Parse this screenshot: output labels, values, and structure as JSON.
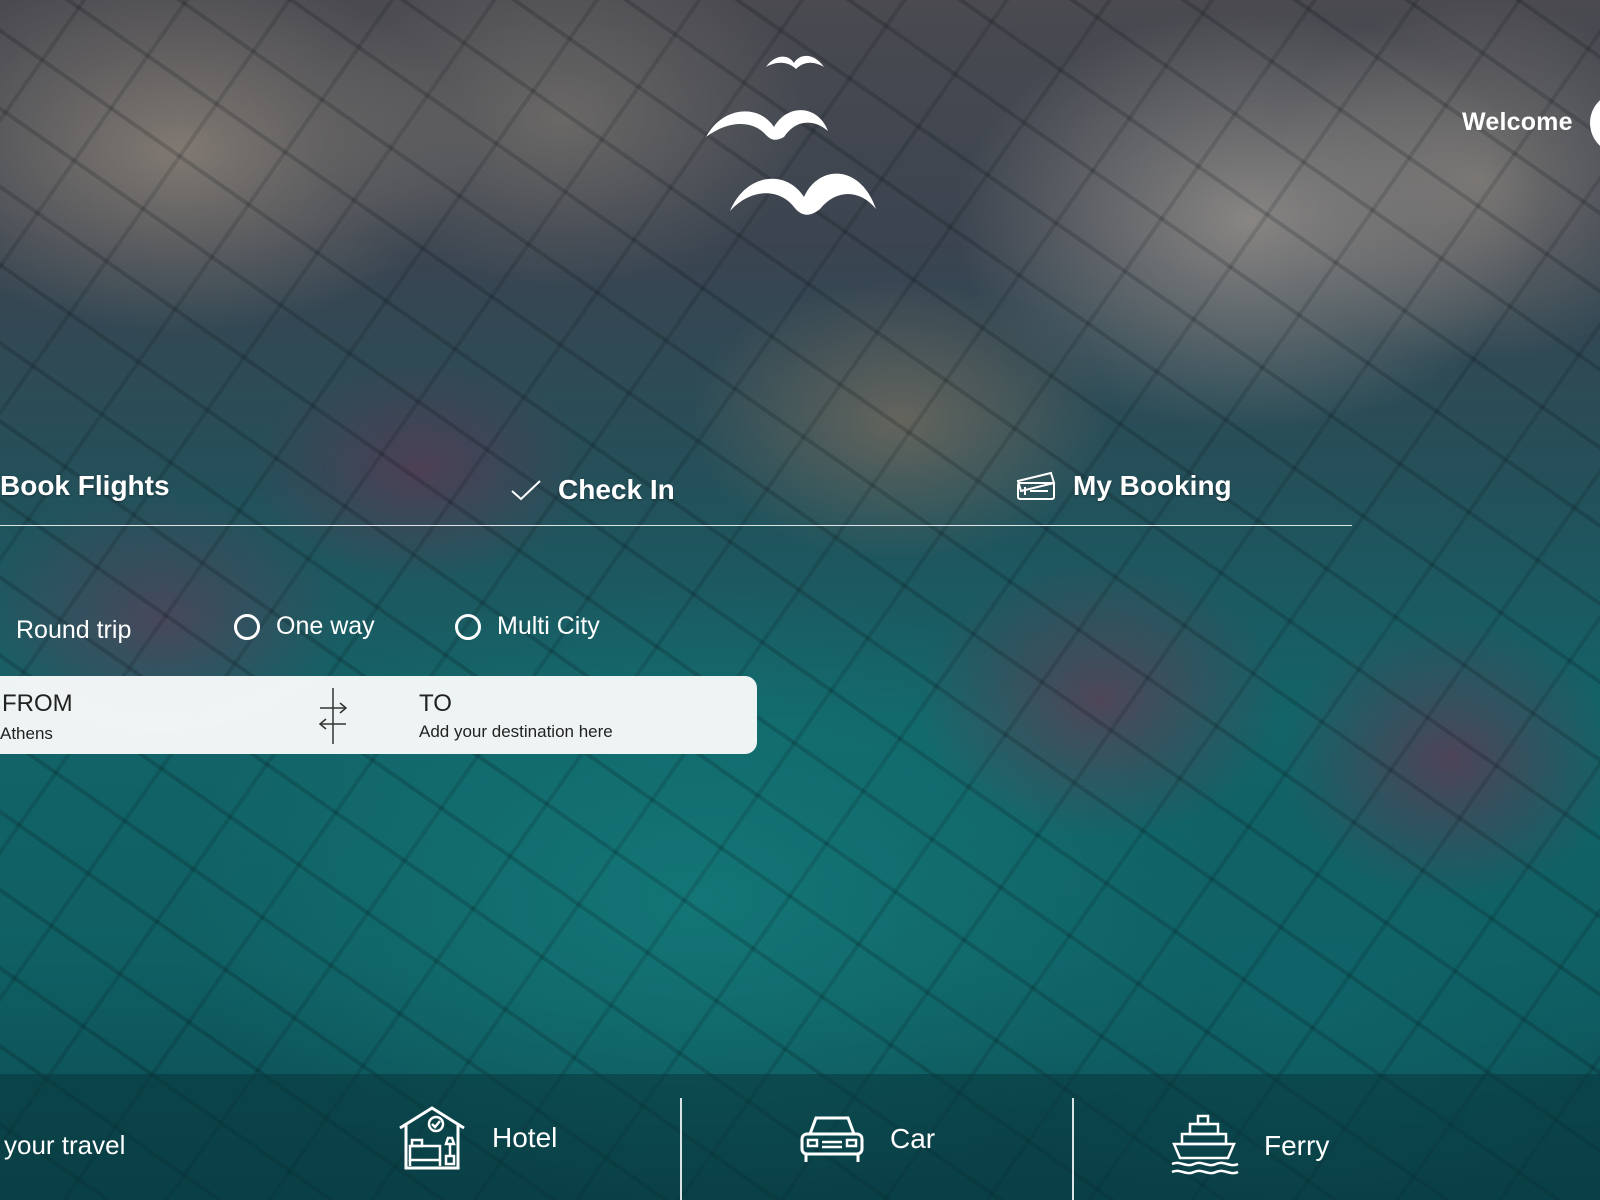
{
  "header": {
    "welcome_text": "Welcome",
    "logo_icon": "seagulls-logo-icon"
  },
  "tabs": [
    {
      "label": "Book Flights",
      "icon": "none"
    },
    {
      "label": "Check In",
      "icon": "checkmark-icon"
    },
    {
      "label": "My Booking",
      "icon": "ticket-icon"
    }
  ],
  "trip_types": [
    {
      "label": "Round trip"
    },
    {
      "label": "One way"
    },
    {
      "label": "Multi City"
    }
  ],
  "route": {
    "from_label": "FROM",
    "from_value": "Athens",
    "to_label": "TO",
    "to_placeholder": "Add your destination here",
    "swap_icon": "swap-arrows-icon"
  },
  "services": {
    "intro_text": "your travel",
    "items": [
      {
        "label": "Hotel",
        "icon": "hotel-icon"
      },
      {
        "label": "Car",
        "icon": "car-icon"
      },
      {
        "label": "Ferry",
        "icon": "ferry-icon"
      }
    ]
  },
  "colors": {
    "text": "#ffffff",
    "panel_bg": "#f8fafa",
    "panel_text": "#222222",
    "services_bar": "#0a373c"
  }
}
